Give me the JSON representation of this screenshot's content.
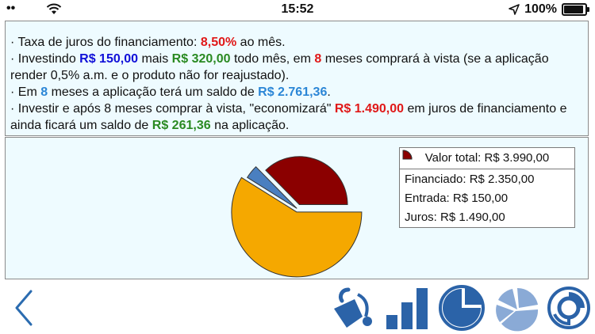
{
  "status": {
    "time": "15:52",
    "battery": "100%",
    "battery_level": 1.0
  },
  "info": {
    "line1": {
      "prefix": "·  Taxa de juros do financiamento: ",
      "rate": "8,50%",
      "suffix": " ao mês."
    },
    "line2": {
      "prefix": "·  Investindo ",
      "initial": "R$ 150,00",
      "mid": " mais ",
      "monthly": "R$ 320,00",
      "mid2": " todo mês, em ",
      "months": "8",
      "suffix": " meses comprará à vista (se a aplicação render 0,5% a.m. e o produto não for reajustado)."
    },
    "line3": {
      "prefix": "·  Em ",
      "months": "8",
      "mid": " meses a aplicação terá um saldo de ",
      "balance": "R$ 2.761,36",
      "suffix": "."
    },
    "line4": {
      "prefix": "·  Investir e após 8 meses comprar à vista, \"economizará\" ",
      "savings": "R$ 1.490,00",
      "mid": " em juros de financiamento e ainda ficará um saldo de ",
      "leftover": "R$ 261,36",
      "suffix": " na aplicação."
    }
  },
  "legend": {
    "title": "Valor total: R$ 3.990,00",
    "items": [
      {
        "label": "Financiado: R$ 2.350,00",
        "color": "#f5a800"
      },
      {
        "label": "Entrada: R$ 150,00",
        "color": "#4a7fc0"
      },
      {
        "label": "Juros: R$ 1.490,00",
        "color": "#8b0000"
      }
    ]
  },
  "chart_data": {
    "type": "pie",
    "title": "Valor total: R$ 3.990,00",
    "slices": [
      {
        "name": "Financiado",
        "value": 2350,
        "color": "#f5a800"
      },
      {
        "name": "Entrada",
        "value": 150,
        "color": "#4a7fc0"
      },
      {
        "name": "Juros",
        "value": 1490,
        "color": "#8b0000"
      }
    ],
    "legend_position": "top-right"
  },
  "toolbar": {
    "buttons": [
      "back-icon",
      "payment-icon",
      "bar-chart-icon",
      "pie-chart-icon",
      "pie-segments-icon",
      "donut-chart-icon"
    ]
  }
}
